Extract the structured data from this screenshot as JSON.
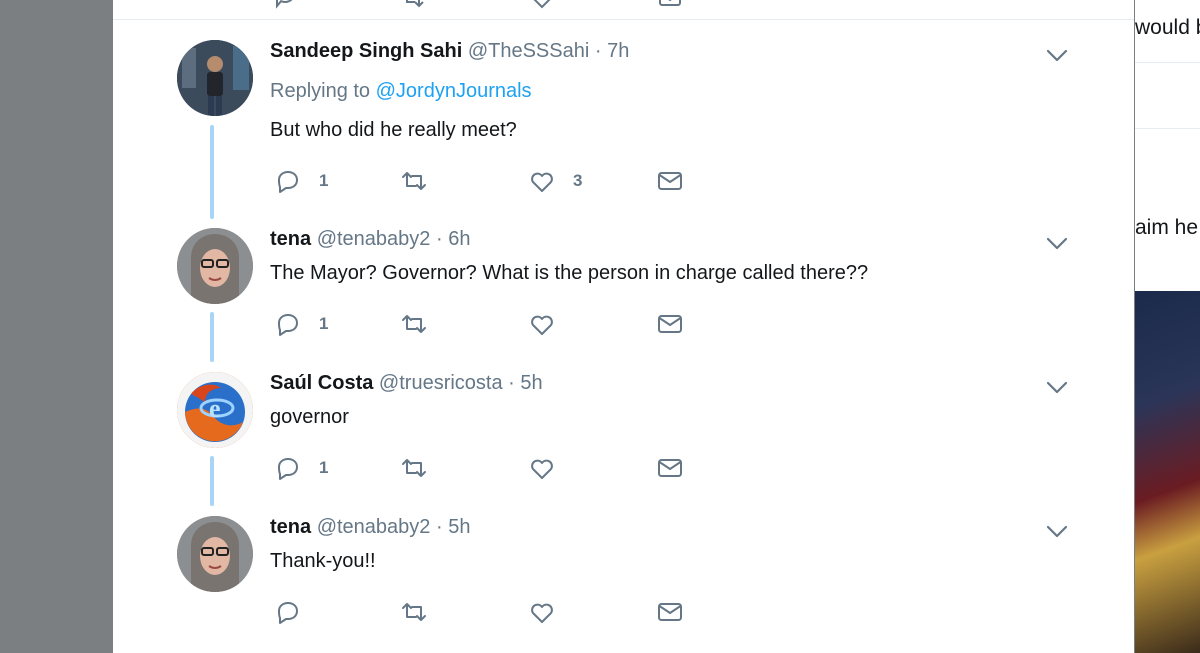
{
  "background_fragments": [
    "would b",
    "aim he"
  ],
  "colors": {
    "accent": "#1da1f2",
    "thread_line": "#a9d4f5",
    "muted": "#657786",
    "text": "#14171a"
  },
  "tweets": [
    {
      "name": "Sandeep Singh Sahi",
      "handle": "@TheSSSahi",
      "sep": "·",
      "time": "7h",
      "replying_prefix": "Replying to ",
      "replying_to": "@JordynJournals",
      "text": "But who did he really meet?",
      "reply_count": "1",
      "retweet_count": "",
      "like_count": "3"
    },
    {
      "name": "tena",
      "handle": "@tenababy2",
      "sep": "·",
      "time": "6h",
      "text": "The Mayor? Governor? What is the person in charge called there??",
      "reply_count": "1",
      "retweet_count": "",
      "like_count": ""
    },
    {
      "name": "Saúl Costa",
      "handle": "@truesricosta",
      "sep": "·",
      "time": "5h",
      "text": "governor",
      "reply_count": "1",
      "retweet_count": "",
      "like_count": ""
    },
    {
      "name": "tena",
      "handle": "@tenababy2",
      "sep": "·",
      "time": "5h",
      "text": "Thank-you!!",
      "reply_count": "",
      "retweet_count": "",
      "like_count": ""
    }
  ]
}
